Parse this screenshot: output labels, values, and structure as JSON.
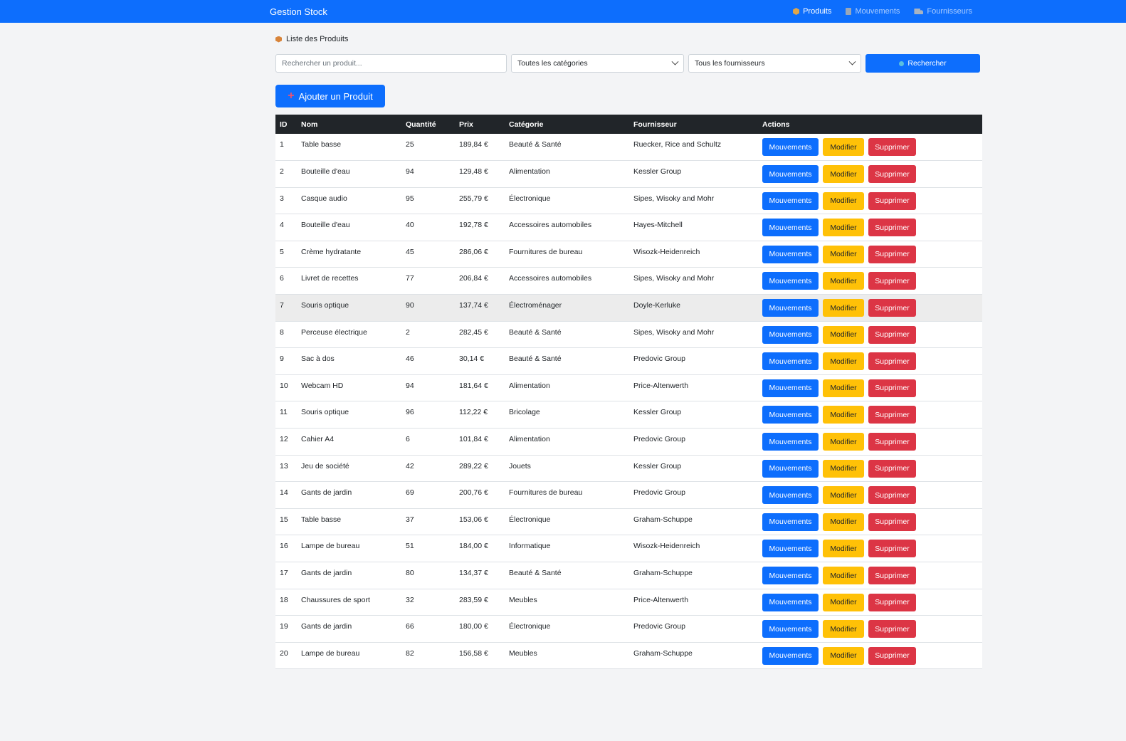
{
  "nav": {
    "brand": "Gestion Stock",
    "links": [
      {
        "label": "Produits",
        "icon": "box-icon",
        "active": true
      },
      {
        "label": "Mouvements",
        "icon": "document-icon",
        "active": false
      },
      {
        "label": "Fournisseurs",
        "icon": "truck-icon",
        "active": false
      }
    ]
  },
  "page": {
    "title": "Liste des Produits"
  },
  "search": {
    "placeholder": "Rechercher un produit...",
    "category_selected": "Toutes les catégories",
    "supplier_selected": "Tous les fournisseurs",
    "button_label": "Rechercher"
  },
  "add_button_label": "Ajouter un Produit",
  "table": {
    "headers": [
      "ID",
      "Nom",
      "Quantité",
      "Prix",
      "Catégorie",
      "Fournisseur",
      "Actions"
    ],
    "action_labels": {
      "movements": "Mouvements",
      "edit": "Modifier",
      "delete": "Supprimer"
    },
    "rows": [
      [
        "1",
        "Table basse",
        "25",
        "189,84 €",
        "Beauté & Santé",
        "Ruecker, Rice and Schultz"
      ],
      [
        "2",
        "Bouteille d'eau",
        "94",
        "129,48 €",
        "Alimentation",
        "Kessler Group"
      ],
      [
        "3",
        "Casque audio",
        "95",
        "255,79 €",
        "Électronique",
        "Sipes, Wisoky and Mohr"
      ],
      [
        "4",
        "Bouteille d'eau",
        "40",
        "192,78 €",
        "Accessoires automobiles",
        "Hayes-Mitchell"
      ],
      [
        "5",
        "Crème hydratante",
        "45",
        "286,06 €",
        "Fournitures de bureau",
        "Wisozk-Heidenreich"
      ],
      [
        "6",
        "Livret de recettes",
        "77",
        "206,84 €",
        "Accessoires automobiles",
        "Sipes, Wisoky and Mohr"
      ],
      [
        "7",
        "Souris optique",
        "90",
        "137,74 €",
        "Électroménager",
        "Doyle-Kerluke"
      ],
      [
        "8",
        "Perceuse électrique",
        "2",
        "282,45 €",
        "Beauté & Santé",
        "Sipes, Wisoky and Mohr"
      ],
      [
        "9",
        "Sac à dos",
        "46",
        "30,14 €",
        "Beauté & Santé",
        "Predovic Group"
      ],
      [
        "10",
        "Webcam HD",
        "94",
        "181,64 €",
        "Alimentation",
        "Price-Altenwerth"
      ],
      [
        "11",
        "Souris optique",
        "96",
        "112,22 €",
        "Bricolage",
        "Kessler Group"
      ],
      [
        "12",
        "Cahier A4",
        "6",
        "101,84 €",
        "Alimentation",
        "Predovic Group"
      ],
      [
        "13",
        "Jeu de société",
        "42",
        "289,22 €",
        "Jouets",
        "Kessler Group"
      ],
      [
        "14",
        "Gants de jardin",
        "69",
        "200,76 €",
        "Fournitures de bureau",
        "Predovic Group"
      ],
      [
        "15",
        "Table basse",
        "37",
        "153,06 €",
        "Électronique",
        "Graham-Schuppe"
      ],
      [
        "16",
        "Lampe de bureau",
        "51",
        "184,00 €",
        "Informatique",
        "Wisozk-Heidenreich"
      ],
      [
        "17",
        "Gants de jardin",
        "80",
        "134,37 €",
        "Beauté & Santé",
        "Graham-Schuppe"
      ],
      [
        "18",
        "Chaussures de sport",
        "32",
        "283,59 €",
        "Meubles",
        "Price-Altenwerth"
      ],
      [
        "19",
        "Gants de jardin",
        "66",
        "180,00 €",
        "Électronique",
        "Predovic Group"
      ],
      [
        "20",
        "Lampe de bureau",
        "82",
        "156,58 €",
        "Meubles",
        "Graham-Schuppe"
      ]
    ],
    "highlighted_row_id": "7"
  },
  "colors": {
    "primary": "#0d6efd",
    "warning": "#ffc107",
    "danger": "#dc3545",
    "header": "#212529"
  }
}
